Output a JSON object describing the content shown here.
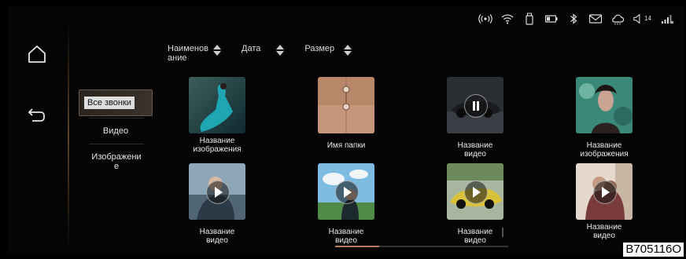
{
  "status_bar": {
    "icons": [
      "hotspot-icon",
      "wifi-icon",
      "usb-icon",
      "battery-icon",
      "bluetooth-icon",
      "mail-icon",
      "cloud-icon",
      "volume-icon",
      "signal-icon"
    ],
    "volume_level": "14"
  },
  "left_nav": {
    "items": [
      "home-icon",
      "back-icon"
    ]
  },
  "sort_bar": {
    "items": [
      {
        "label": "Наименование"
      },
      {
        "label": "Дата"
      },
      {
        "label": "Размер"
      }
    ]
  },
  "categories": {
    "items": [
      {
        "label": "Все звонки",
        "active": true
      },
      {
        "label": "Видео",
        "active": false
      },
      {
        "label": "Изображение",
        "active": false
      }
    ]
  },
  "grid": {
    "items": [
      {
        "caption": "Название изображения",
        "type": "image",
        "overlay": "none"
      },
      {
        "caption": "Имя папки",
        "type": "folder",
        "overlay": "none"
      },
      {
        "caption": "Название видео",
        "type": "video",
        "overlay": "pause"
      },
      {
        "caption": "Название изображения",
        "type": "image",
        "overlay": "none"
      },
      {
        "caption": "Название видео",
        "type": "video",
        "overlay": "play"
      },
      {
        "caption": "Название видео",
        "type": "video",
        "overlay": "play"
      },
      {
        "caption": "Название видео",
        "type": "video",
        "overlay": "play"
      },
      {
        "caption": "Название видео",
        "type": "video",
        "overlay": "play"
      }
    ]
  },
  "figure_code": "B705116O",
  "colors": {
    "accent": "#b9805b",
    "background": "#050505"
  }
}
